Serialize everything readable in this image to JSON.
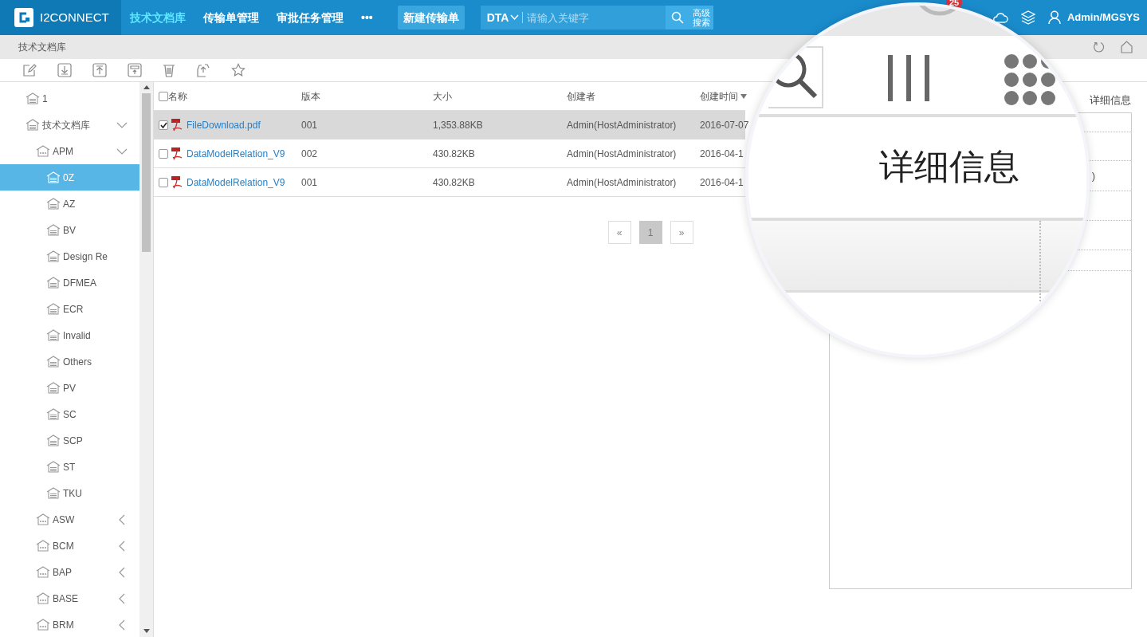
{
  "topbar": {
    "logo": "I2CONNECT",
    "nav": [
      {
        "label": "技术文档库",
        "selected": true
      },
      {
        "label": "传输单管理",
        "selected": false
      },
      {
        "label": "审批任务管理",
        "selected": false
      },
      {
        "label": "•••",
        "selected": false
      }
    ],
    "new_button": "新建传输单",
    "search": {
      "scope": "DTA",
      "placeholder": "请输入关键字"
    },
    "advanced_search": "高级搜索",
    "notification_badge": "25",
    "user": "Admin/MGSYS"
  },
  "breadcrumb": "技术文档库",
  "tree": [
    {
      "label": "1",
      "selected": false
    },
    {
      "label": "技术文档库",
      "selected": false,
      "expanded": true,
      "children": [
        {
          "label": "APM",
          "selected": false,
          "expanded": true,
          "children": [
            {
              "label": "0Z",
              "selected": true
            },
            {
              "label": "AZ",
              "selected": false
            },
            {
              "label": "BV",
              "selected": false
            },
            {
              "label": "Design Re",
              "selected": false
            },
            {
              "label": "DFMEA",
              "selected": false
            },
            {
              "label": "ECR",
              "selected": false
            },
            {
              "label": "Invalid",
              "selected": false
            },
            {
              "label": "Others",
              "selected": false
            },
            {
              "label": "PV",
              "selected": false
            },
            {
              "label": "SC",
              "selected": false
            },
            {
              "label": "SCP",
              "selected": false
            },
            {
              "label": "ST",
              "selected": false
            },
            {
              "label": "TKU",
              "selected": false
            }
          ]
        },
        {
          "label": "ASW",
          "selected": false,
          "expanded": false
        },
        {
          "label": "BCM",
          "selected": false,
          "expanded": false
        },
        {
          "label": "BAP",
          "selected": false,
          "expanded": false
        },
        {
          "label": "BASE",
          "selected": false,
          "expanded": false
        },
        {
          "label": "BRM",
          "selected": false,
          "expanded": false
        }
      ]
    }
  ],
  "table": {
    "all_checked": false,
    "columns": [
      {
        "label": "名称",
        "sorted": false
      },
      {
        "label": "版本",
        "sorted": false
      },
      {
        "label": "大小",
        "sorted": false
      },
      {
        "label": "创建者",
        "sorted": false
      },
      {
        "label": "创建时间",
        "sorted": true
      }
    ],
    "rows": [
      {
        "checked": true,
        "selected": true,
        "cells": [
          "FileDownload.pdf",
          "001",
          "1,353.88KB",
          "Admin(HostAdministrator)",
          "2016-07-07"
        ]
      },
      {
        "checked": false,
        "selected": false,
        "cells": [
          "DataModelRelation_V9",
          "002",
          "430.82KB",
          "Admin(HostAdministrator)",
          "2016-04-1"
        ]
      },
      {
        "checked": false,
        "selected": false,
        "cells": [
          "DataModelRelation_V9",
          "001",
          "430.82KB",
          "Admin(HostAdministrator)",
          "2016-04-1"
        ]
      }
    ]
  },
  "pagination": {
    "prev": "«",
    "pages": [
      {
        "label": "1",
        "selected": true
      }
    ],
    "next": "»"
  },
  "detail_panel": {
    "title": "详细信息",
    "cell": ")"
  },
  "magnifier": {
    "label": "详细信息"
  }
}
